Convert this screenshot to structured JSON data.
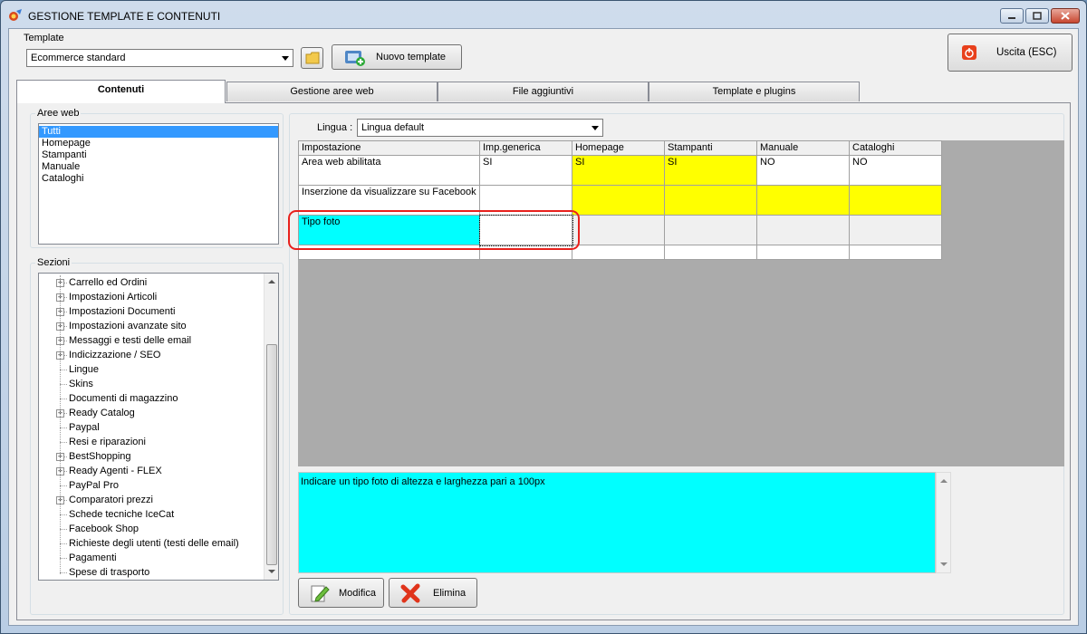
{
  "window": {
    "title": "GESTIONE TEMPLATE E CONTENUTI"
  },
  "template": {
    "label": "Template",
    "selected": "Ecommerce standard",
    "new_button": "Nuovo template"
  },
  "exit_button": "Uscita (ESC)",
  "tabs": [
    "Contenuti",
    "Gestione aree web",
    "File aggiuntivi",
    "Template e plugins"
  ],
  "aree_web": {
    "title": "Aree web",
    "items": [
      "Tutti",
      "Homepage",
      "Stampanti",
      "Manuale",
      "Cataloghi"
    ],
    "selected_index": 0
  },
  "sezioni": {
    "title": "Sezioni",
    "items": [
      {
        "label": "Carrello ed Ordini",
        "expandable": true
      },
      {
        "label": "Impostazioni Articoli",
        "expandable": true
      },
      {
        "label": "Impostazioni Documenti",
        "expandable": true
      },
      {
        "label": "Impostazioni avanzate sito",
        "expandable": true
      },
      {
        "label": "Messaggi e testi delle email",
        "expandable": true
      },
      {
        "label": "Indicizzazione / SEO",
        "expandable": true
      },
      {
        "label": "Lingue",
        "expandable": false
      },
      {
        "label": "Skins",
        "expandable": false
      },
      {
        "label": "Documenti di magazzino",
        "expandable": false
      },
      {
        "label": "Ready Catalog",
        "expandable": true
      },
      {
        "label": "Paypal",
        "expandable": false
      },
      {
        "label": "Resi e riparazioni",
        "expandable": false
      },
      {
        "label": "BestShopping",
        "expandable": true
      },
      {
        "label": "Ready Agenti - FLEX",
        "expandable": true
      },
      {
        "label": "PayPal Pro",
        "expandable": false
      },
      {
        "label": "Comparatori prezzi",
        "expandable": true
      },
      {
        "label": "Schede tecniche IceCat",
        "expandable": false
      },
      {
        "label": "Facebook Shop",
        "expandable": false
      },
      {
        "label": "Richieste degli utenti (testi delle email)",
        "expandable": false
      },
      {
        "label": "Pagamenti",
        "expandable": false
      },
      {
        "label": "Spese di trasporto",
        "expandable": false
      }
    ]
  },
  "lingua": {
    "label": "Lingua :",
    "selected": "Lingua default"
  },
  "grid": {
    "headers": [
      "Impostazione",
      "Imp.generica",
      "Homepage",
      "Stampanti",
      "Manuale",
      "Cataloghi"
    ],
    "rows": [
      {
        "cells": [
          "Area web abilitata",
          "SI",
          "SI",
          "SI",
          "NO",
          "NO"
        ],
        "colors": [
          "#ffffff",
          "#ffffff",
          "#ffff00",
          "#ffff00",
          "#ffffff",
          "#ffffff"
        ]
      },
      {
        "cells": [
          "Inserzione da visualizzare su Facebook",
          "",
          "",
          "",
          "",
          ""
        ],
        "colors": [
          "#ffffff",
          "#ffffff",
          "#ffff00",
          "#ffff00",
          "#ffff00",
          "#ffff00"
        ]
      },
      {
        "cells": [
          "Tipo foto",
          "",
          "",
          "",
          "",
          ""
        ],
        "colors": [
          "#00ffff",
          "#ffffff",
          "#f0f0f0",
          "#f0f0f0",
          "#f0f0f0",
          "#f0f0f0"
        ]
      },
      {
        "cells": [
          "",
          "",
          "",
          "",
          "",
          ""
        ],
        "colors": [
          "#ffffff",
          "#ffffff",
          "#ffffff",
          "#ffffff",
          "#ffffff",
          "#ffffff"
        ]
      }
    ]
  },
  "description": "Indicare un tipo foto di altezza e larghezza pari a 100px",
  "buttons": {
    "modifica": "Modifica",
    "elimina": "Elimina"
  },
  "colors": {
    "highlight_ring": "#e8201c",
    "cyan": "#00ffff",
    "yellow": "#ffff00"
  }
}
